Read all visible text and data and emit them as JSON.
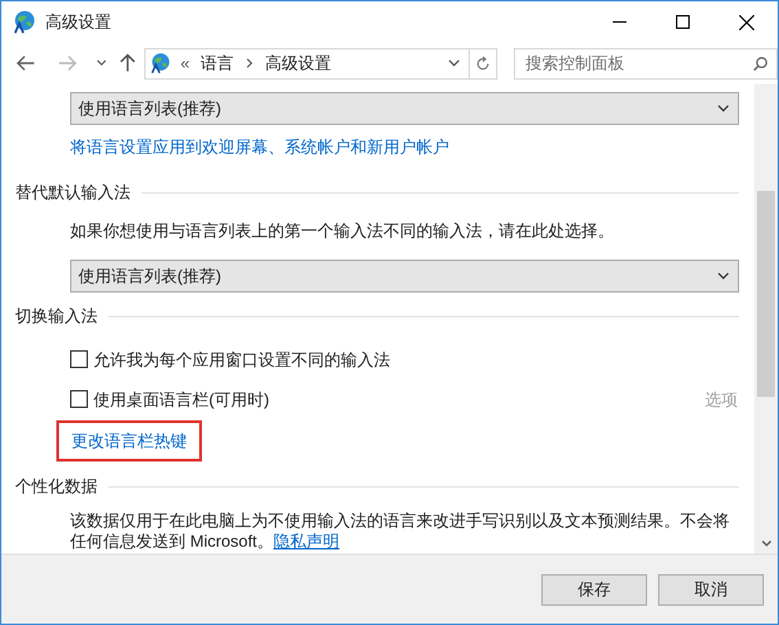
{
  "window": {
    "title": "高级设置"
  },
  "address": {
    "overflow": "«",
    "breadcrumb": [
      "语言",
      "高级设置"
    ]
  },
  "search": {
    "placeholder": "搜索控制面板"
  },
  "content": [
    {
      "kind": "dropdown",
      "value": "使用语言列表(推荐)"
    },
    {
      "kind": "link",
      "text": "将语言设置应用到欢迎屏幕、系统帐户和新用户帐户",
      "highlighted": false
    },
    {
      "kind": "heading",
      "text": "替代默认输入法"
    },
    {
      "kind": "text",
      "text": "如果你想使用与语言列表上的第一个输入法不同的输入法，请在此处选择。"
    },
    {
      "kind": "dropdown",
      "value": "使用语言列表(推荐)"
    },
    {
      "kind": "heading",
      "text": "切换输入法"
    },
    {
      "kind": "checkbox",
      "label": "允许我为每个应用窗口设置不同的输入法",
      "checked": false
    },
    {
      "kind": "checkbox",
      "label": "使用桌面语言栏(可用时)",
      "checked": false,
      "option": {
        "label": "选项",
        "disabled": true
      }
    },
    {
      "kind": "link",
      "text": "更改语言栏热键",
      "highlighted": true
    },
    {
      "kind": "heading",
      "text": "个性化数据"
    },
    {
      "kind": "paragraph",
      "text": "该数据仅用于在此电脑上为不使用输入法的语言来改进手写识别以及文本预测结果。不会将任何信息发送到 Microsoft。",
      "link": "隐私声明"
    }
  ],
  "buttons": [
    {
      "label": "保存"
    },
    {
      "label": "取消"
    }
  ]
}
